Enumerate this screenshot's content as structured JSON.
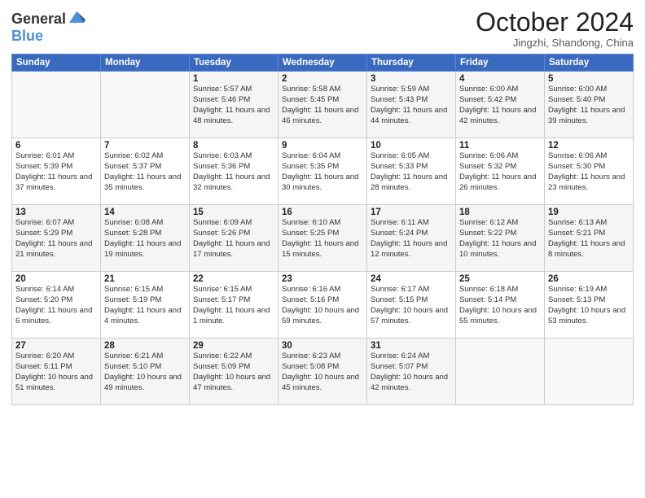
{
  "logo": {
    "general": "General",
    "blue": "Blue"
  },
  "header": {
    "month": "October 2024",
    "location": "Jingzhi, Shandong, China"
  },
  "weekdays": [
    "Sunday",
    "Monday",
    "Tuesday",
    "Wednesday",
    "Thursday",
    "Friday",
    "Saturday"
  ],
  "weeks": [
    [
      {
        "day": "",
        "info": ""
      },
      {
        "day": "",
        "info": ""
      },
      {
        "day": "1",
        "info": "Sunrise: 5:57 AM\nSunset: 5:46 PM\nDaylight: 11 hours and 48 minutes."
      },
      {
        "day": "2",
        "info": "Sunrise: 5:58 AM\nSunset: 5:45 PM\nDaylight: 11 hours and 46 minutes."
      },
      {
        "day": "3",
        "info": "Sunrise: 5:59 AM\nSunset: 5:43 PM\nDaylight: 11 hours and 44 minutes."
      },
      {
        "day": "4",
        "info": "Sunrise: 6:00 AM\nSunset: 5:42 PM\nDaylight: 11 hours and 42 minutes."
      },
      {
        "day": "5",
        "info": "Sunrise: 6:00 AM\nSunset: 5:40 PM\nDaylight: 11 hours and 39 minutes."
      }
    ],
    [
      {
        "day": "6",
        "info": "Sunrise: 6:01 AM\nSunset: 5:39 PM\nDaylight: 11 hours and 37 minutes."
      },
      {
        "day": "7",
        "info": "Sunrise: 6:02 AM\nSunset: 5:37 PM\nDaylight: 11 hours and 35 minutes."
      },
      {
        "day": "8",
        "info": "Sunrise: 6:03 AM\nSunset: 5:36 PM\nDaylight: 11 hours and 32 minutes."
      },
      {
        "day": "9",
        "info": "Sunrise: 6:04 AM\nSunset: 5:35 PM\nDaylight: 11 hours and 30 minutes."
      },
      {
        "day": "10",
        "info": "Sunrise: 6:05 AM\nSunset: 5:33 PM\nDaylight: 11 hours and 28 minutes."
      },
      {
        "day": "11",
        "info": "Sunrise: 6:06 AM\nSunset: 5:32 PM\nDaylight: 11 hours and 26 minutes."
      },
      {
        "day": "12",
        "info": "Sunrise: 6:06 AM\nSunset: 5:30 PM\nDaylight: 11 hours and 23 minutes."
      }
    ],
    [
      {
        "day": "13",
        "info": "Sunrise: 6:07 AM\nSunset: 5:29 PM\nDaylight: 11 hours and 21 minutes."
      },
      {
        "day": "14",
        "info": "Sunrise: 6:08 AM\nSunset: 5:28 PM\nDaylight: 11 hours and 19 minutes."
      },
      {
        "day": "15",
        "info": "Sunrise: 6:09 AM\nSunset: 5:26 PM\nDaylight: 11 hours and 17 minutes."
      },
      {
        "day": "16",
        "info": "Sunrise: 6:10 AM\nSunset: 5:25 PM\nDaylight: 11 hours and 15 minutes."
      },
      {
        "day": "17",
        "info": "Sunrise: 6:11 AM\nSunset: 5:24 PM\nDaylight: 11 hours and 12 minutes."
      },
      {
        "day": "18",
        "info": "Sunrise: 6:12 AM\nSunset: 5:22 PM\nDaylight: 11 hours and 10 minutes."
      },
      {
        "day": "19",
        "info": "Sunrise: 6:13 AM\nSunset: 5:21 PM\nDaylight: 11 hours and 8 minutes."
      }
    ],
    [
      {
        "day": "20",
        "info": "Sunrise: 6:14 AM\nSunset: 5:20 PM\nDaylight: 11 hours and 6 minutes."
      },
      {
        "day": "21",
        "info": "Sunrise: 6:15 AM\nSunset: 5:19 PM\nDaylight: 11 hours and 4 minutes."
      },
      {
        "day": "22",
        "info": "Sunrise: 6:15 AM\nSunset: 5:17 PM\nDaylight: 11 hours and 1 minute."
      },
      {
        "day": "23",
        "info": "Sunrise: 6:16 AM\nSunset: 5:16 PM\nDaylight: 10 hours and 59 minutes."
      },
      {
        "day": "24",
        "info": "Sunrise: 6:17 AM\nSunset: 5:15 PM\nDaylight: 10 hours and 57 minutes."
      },
      {
        "day": "25",
        "info": "Sunrise: 6:18 AM\nSunset: 5:14 PM\nDaylight: 10 hours and 55 minutes."
      },
      {
        "day": "26",
        "info": "Sunrise: 6:19 AM\nSunset: 5:13 PM\nDaylight: 10 hours and 53 minutes."
      }
    ],
    [
      {
        "day": "27",
        "info": "Sunrise: 6:20 AM\nSunset: 5:11 PM\nDaylight: 10 hours and 51 minutes."
      },
      {
        "day": "28",
        "info": "Sunrise: 6:21 AM\nSunset: 5:10 PM\nDaylight: 10 hours and 49 minutes."
      },
      {
        "day": "29",
        "info": "Sunrise: 6:22 AM\nSunset: 5:09 PM\nDaylight: 10 hours and 47 minutes."
      },
      {
        "day": "30",
        "info": "Sunrise: 6:23 AM\nSunset: 5:08 PM\nDaylight: 10 hours and 45 minutes."
      },
      {
        "day": "31",
        "info": "Sunrise: 6:24 AM\nSunset: 5:07 PM\nDaylight: 10 hours and 42 minutes."
      },
      {
        "day": "",
        "info": ""
      },
      {
        "day": "",
        "info": ""
      }
    ]
  ]
}
